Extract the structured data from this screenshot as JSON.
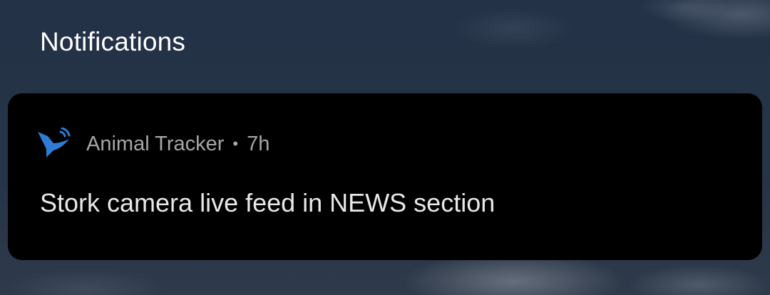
{
  "header": {
    "title": "Notifications"
  },
  "notification": {
    "app_icon": "animal-tracker-bird-icon",
    "app_name": "Animal Tracker",
    "separator": "•",
    "time": "7h",
    "message": "Stork camera live feed in NEWS section",
    "accent_color": "#2f7cd6"
  }
}
